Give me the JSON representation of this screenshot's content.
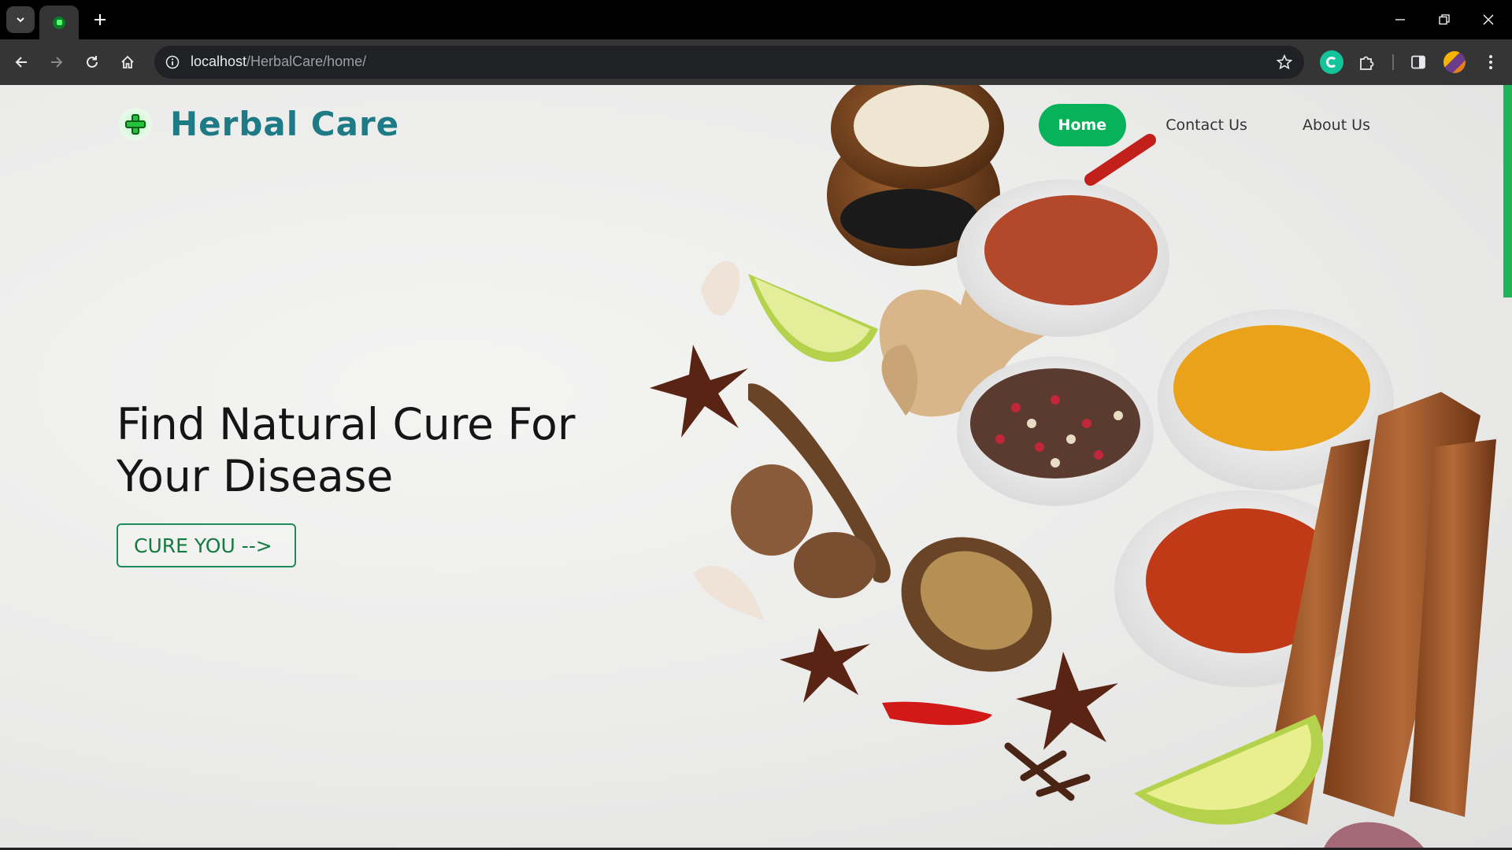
{
  "browser": {
    "url_host": "localhost",
    "url_path": "/HerbalCare/home/"
  },
  "site": {
    "brand": "Herbal Care",
    "nav": [
      {
        "label": "Home",
        "active": true
      },
      {
        "label": "Contact Us",
        "active": false
      },
      {
        "label": "About Us",
        "active": false
      }
    ],
    "hero": {
      "title_line1": "Find Natural Cure For",
      "title_line2": "Your Disease",
      "cta_label": "CURE YOU -->"
    }
  },
  "colors": {
    "accent": "#07b25a",
    "brand_text": "#1e7b86",
    "cta_text": "#157a40"
  }
}
